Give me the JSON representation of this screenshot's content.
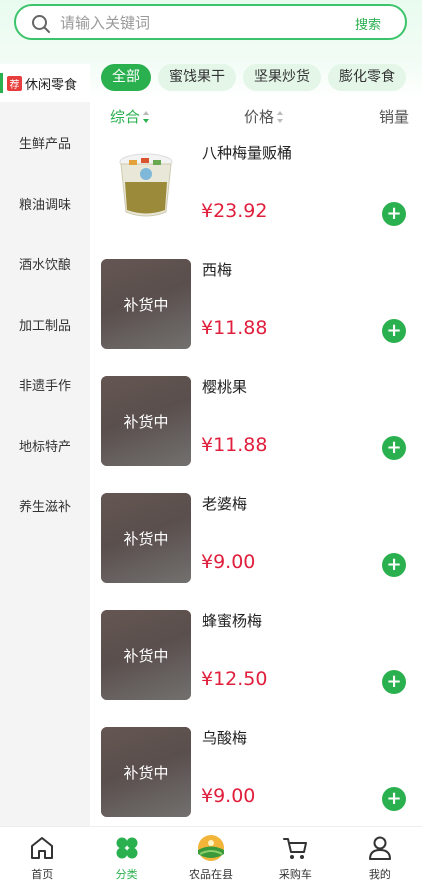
{
  "search": {
    "placeholder": "请输入关键词",
    "button": "搜索"
  },
  "sidebar": {
    "active": {
      "badge": "荐",
      "label": "休闲零食"
    },
    "items": [
      "生鲜产品",
      "粮油调味",
      "酒水饮酿",
      "加工制品",
      "非遗手作",
      "地标特产",
      "养生滋补"
    ]
  },
  "chips": [
    "全部",
    "蜜饯果干",
    "坚果炒货",
    "膨化零食"
  ],
  "sort": {
    "comprehensive": "综合",
    "price": "价格",
    "sales": "销量"
  },
  "products": [
    {
      "name": "八种梅量贩桶",
      "price": "¥23.92",
      "status": ""
    },
    {
      "name": "西梅",
      "price": "¥11.88",
      "status": "补货中"
    },
    {
      "name": "樱桃果",
      "price": "¥11.88",
      "status": "补货中"
    },
    {
      "name": "老婆梅",
      "price": "¥9.00",
      "status": "补货中"
    },
    {
      "name": "蜂蜜杨梅",
      "price": "¥12.50",
      "status": "补货中"
    },
    {
      "name": "乌酸梅",
      "price": "¥9.00",
      "status": "补货中"
    }
  ],
  "tabs": [
    "首页",
    "分类",
    "农品在县",
    "采购车",
    "我的"
  ],
  "colors": {
    "accent": "#2bb04f",
    "price": "#e01f3d",
    "badge": "#e73d3d"
  }
}
